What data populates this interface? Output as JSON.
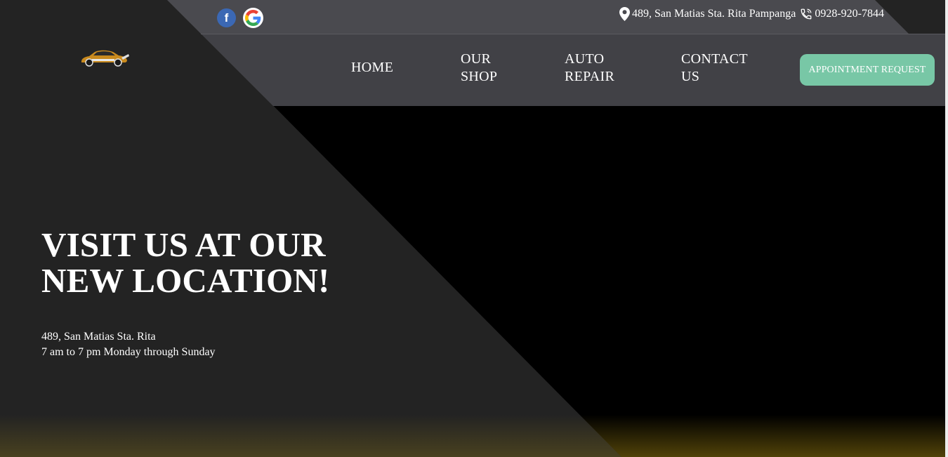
{
  "topbar": {
    "social": [
      {
        "name": "facebook-icon",
        "glyph": "f"
      },
      {
        "name": "google-icon",
        "glyph": "G"
      }
    ],
    "address": "489, San Matias Sta. Rita Pampanga",
    "phone": "0928-920-7844"
  },
  "nav": {
    "home": "HOME",
    "shop_line1": "OUR",
    "shop_line2": "SHOP",
    "repair_line1": "AUTO",
    "repair_line2": "REPAIR",
    "contact_line1": "CONTACT",
    "contact_line2": "US",
    "appointment_button": "APPOINTMENT REQUEST"
  },
  "hero": {
    "title_line1": "VISIT US AT OUR",
    "title_line2": "NEW LOCATION!",
    "address": "489, San Matias Sta. Rita",
    "hours": "7 am to 7 pm Monday through Sunday"
  },
  "colors": {
    "button": "#78c7a6",
    "header_top": "#4a4a4f",
    "header_nav": "#414146",
    "diagonal_panel": "#232323",
    "gold_glow": "#5f4e0a"
  }
}
